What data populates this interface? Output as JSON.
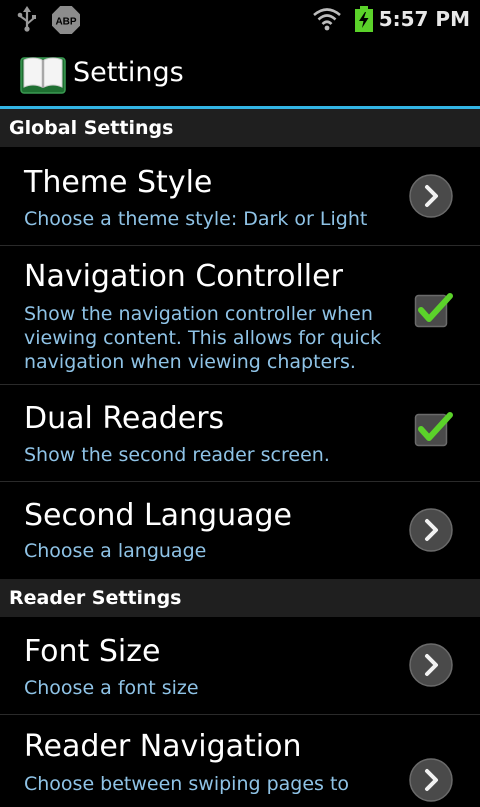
{
  "status_bar": {
    "time": "5:57 PM",
    "adblock_label": "ABP",
    "icons": [
      "usb-icon",
      "adblock-icon",
      "wifi-icon",
      "battery-charging-icon"
    ]
  },
  "title_bar": {
    "title": "Settings",
    "icon": "book-icon"
  },
  "colors": {
    "accent": "#33b5e5",
    "summary": "#8fc3e6",
    "check": "#5bd22a",
    "category_bg": "#1f1f1f"
  },
  "global_settings": {
    "header": "Global Settings",
    "theme_style": {
      "title": "Theme Style",
      "summary": "Choose a theme style: Dark or Light",
      "widget": "chevron-right-icon"
    },
    "navigation_controller": {
      "title": "Navigation Controller",
      "summary": "Show the navigation controller when viewing content. This allows for quick navigation when viewing chapters.",
      "checked": true
    },
    "dual_readers": {
      "title": "Dual Readers",
      "summary": "Show the second reader screen.",
      "checked": true
    },
    "second_language": {
      "title": "Second Language",
      "summary": "Choose a language",
      "widget": "chevron-right-icon"
    }
  },
  "reader_settings": {
    "header": "Reader Settings",
    "font_size": {
      "title": "Font Size",
      "summary": "Choose a font size",
      "widget": "chevron-right-icon"
    },
    "reader_navigation": {
      "title": "Reader Navigation",
      "summary": "Choose between swiping pages to",
      "widget": "chevron-right-icon"
    }
  }
}
